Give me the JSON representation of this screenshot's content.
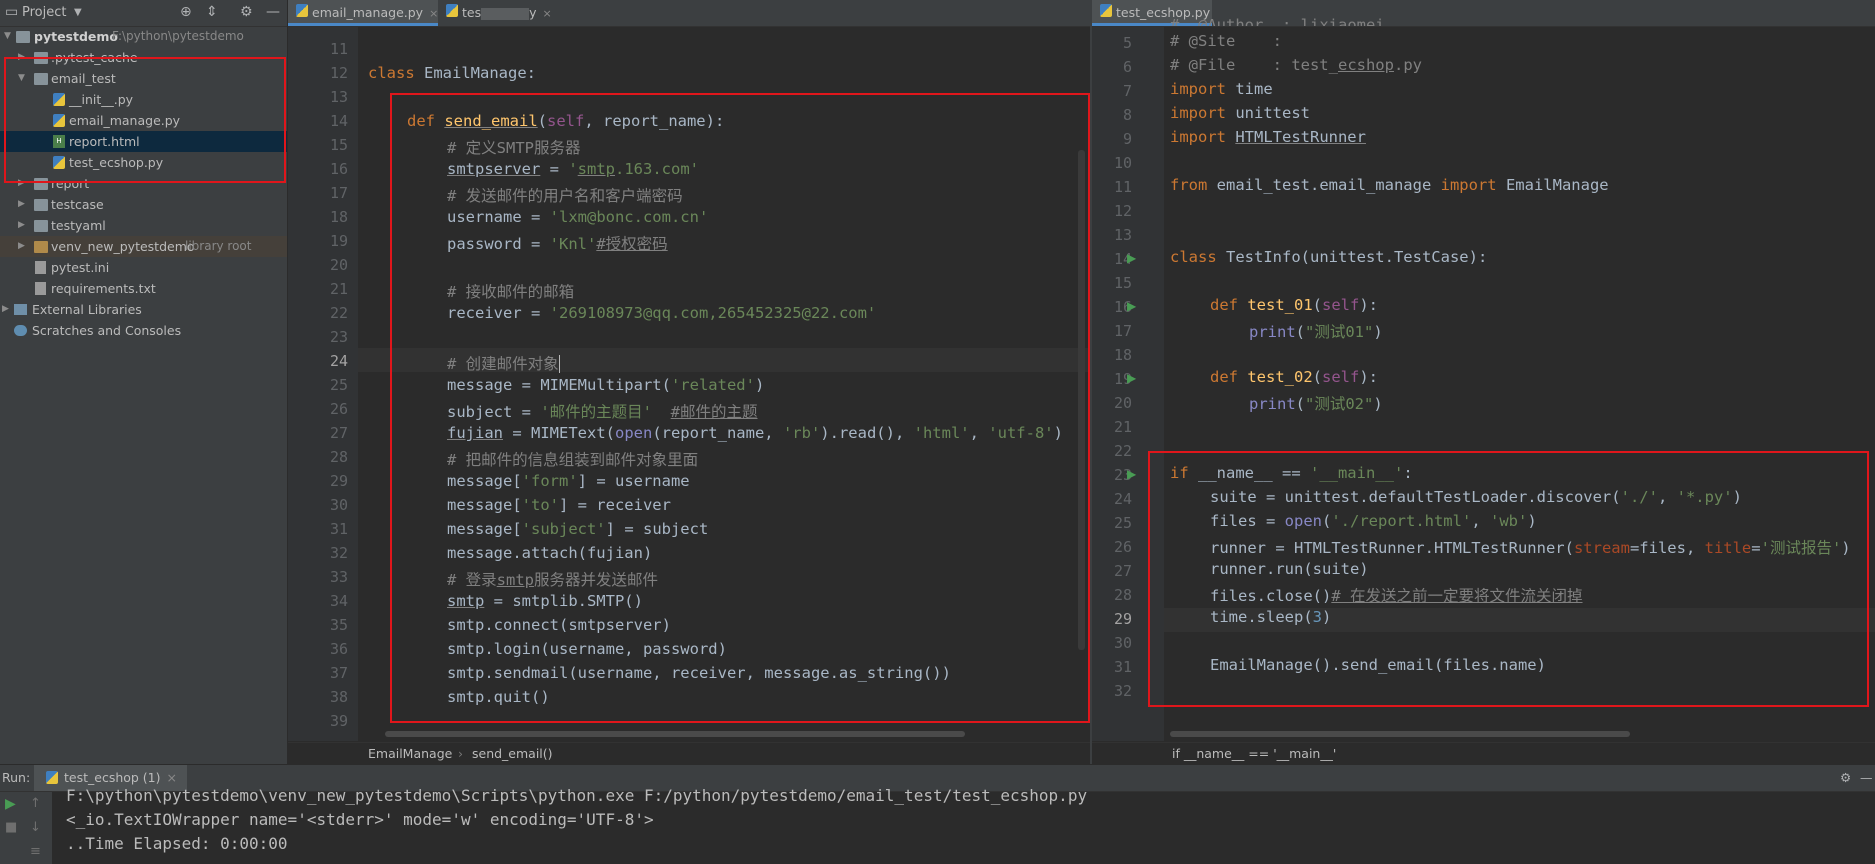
{
  "project_panel": {
    "title": "Project",
    "items": [
      {
        "label": "pytestdemo",
        "path": "F:\\python\\pytestdemo"
      },
      {
        "label": ".pytest_cache"
      },
      {
        "label": "email_test"
      },
      {
        "label": "__init__.py"
      },
      {
        "label": "email_manage.py"
      },
      {
        "label": "report.html"
      },
      {
        "label": "test_ecshop.py"
      },
      {
        "label": "report"
      },
      {
        "label": "testcase"
      },
      {
        "label": "testyaml"
      },
      {
        "label": "venv_new_pytestdemo",
        "note": "library root"
      },
      {
        "label": "pytest.ini"
      },
      {
        "label": "requirements.txt"
      },
      {
        "label": "External Libraries"
      },
      {
        "label": "Scratches and Consoles"
      }
    ]
  },
  "left_editor": {
    "tabs": [
      {
        "label": "email_manage.py"
      },
      {
        "label": "tes"
      },
      {
        "label": "y"
      }
    ],
    "breadcrumb": [
      "EmailManage",
      "send_email()"
    ],
    "line_numbers": [
      "11",
      "12",
      "13",
      "14",
      "15",
      "16",
      "17",
      "18",
      "19",
      "20",
      "21",
      "22",
      "23",
      "24",
      "25",
      "26",
      "27",
      "28",
      "29",
      "30",
      "31",
      "32",
      "33",
      "34",
      "35",
      "36",
      "37",
      "38",
      "39"
    ],
    "current_line": "24"
  },
  "right_editor": {
    "tabs": [
      {
        "label": "test_ecshop.py"
      }
    ],
    "breadcrumb": [
      "if __name__ == '__main__'"
    ],
    "line_numbers": [
      "5",
      "6",
      "7",
      "8",
      "9",
      "10",
      "11",
      "12",
      "13",
      "14",
      "15",
      "16",
      "17",
      "18",
      "19",
      "20",
      "21",
      "22",
      "23",
      "24",
      "25",
      "26",
      "27",
      "28",
      "29",
      "30",
      "31",
      "32"
    ],
    "current_line": "29"
  },
  "run_panel": {
    "label": "Run:",
    "tab": "test_ecshop (1)",
    "console": [
      "F:\\python\\pytestdemo\\venv_new_pytestdemo\\Scripts\\python.exe F:/python/pytestdemo/email_test/test_ecshop.py",
      "<_io.TextIOWrapper name='<stderr>' mode='w' encoding='UTF-8'>",
      "..Time Elapsed: 0:00:00"
    ]
  }
}
